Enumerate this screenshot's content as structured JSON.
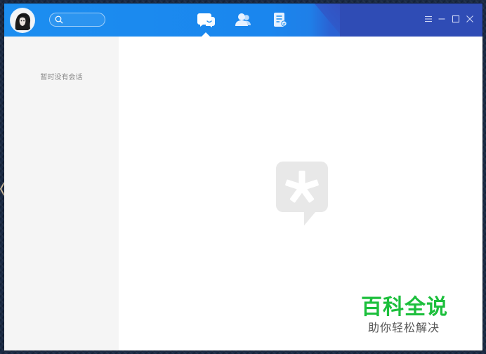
{
  "search": {
    "placeholder": "",
    "value": ""
  },
  "nav": {
    "tabs": [
      {
        "name": "messages",
        "icon": "chat-bubble-icon",
        "active": true
      },
      {
        "name": "contacts",
        "icon": "contacts-icon",
        "active": false
      },
      {
        "name": "documents",
        "icon": "document-icon",
        "active": false
      }
    ]
  },
  "window_controls": {
    "menu": "menu-icon",
    "minimize": "minimize-icon",
    "maximize": "maximize-icon",
    "close": "close-icon"
  },
  "sidebar": {
    "empty_text": "暂时没有会话"
  },
  "watermark": {
    "title": "百科全说",
    "subtitle": "助你轻松解决"
  },
  "colors": {
    "titlebar_start": "#1c8ef0",
    "titlebar_end": "#2c4fb9",
    "sidebar_bg": "#f5f5f5",
    "watermark_green": "#1cbf3c"
  }
}
